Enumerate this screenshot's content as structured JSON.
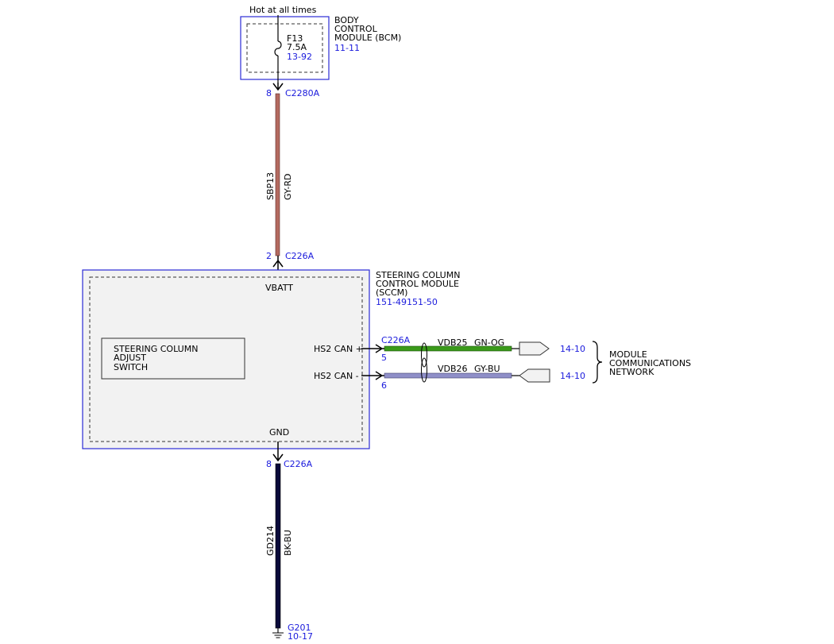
{
  "colors": {
    "module_outline": "#2b2bd6",
    "ref_text": "#1a1adc",
    "module_fill": "#f2f2f2",
    "wire_gy_rd": "#b46a60",
    "wire_gn_og": "#3a9a1a",
    "wire_gy_bu": "#8f8fc8",
    "wire_bk_bu": "#0a0a3a"
  },
  "power": {
    "hot_label": "Hot at all times"
  },
  "bcm": {
    "name_lines": [
      "BODY",
      "CONTROL",
      "MODULE (BCM)"
    ],
    "ref": "11-11",
    "fuse": {
      "id": "F13",
      "rating": "7.5A",
      "ref": "13-92"
    }
  },
  "connectors": {
    "bcm_out": {
      "pin": "8",
      "name": "C2280A"
    },
    "sccm_vbatt": {
      "pin": "2",
      "name": "C226A"
    },
    "sccm_can": {
      "name": "C226A",
      "pin_plus": "5",
      "pin_minus": "6"
    },
    "sccm_gnd": {
      "pin": "8",
      "name": "C226A"
    }
  },
  "wires": {
    "power": {
      "circuit": "SBP13",
      "color": "GY-RD"
    },
    "can_high": {
      "circuit": "VDB25",
      "color": "GN-OG",
      "ref": "14-10"
    },
    "can_low": {
      "circuit": "VDB26",
      "color": "GY-BU",
      "ref": "14-10"
    },
    "ground": {
      "circuit": "GD214",
      "color": "BK-BU"
    }
  },
  "sccm": {
    "name_lines": [
      "STEERING COLUMN",
      "CONTROL MODULE",
      "(SCCM)"
    ],
    "ref": "151-49151-50",
    "vbatt_label": "VBATT",
    "gnd_label": "GND",
    "hs2_plus_label": "HS2 CAN +",
    "hs2_minus_label": "HS2 CAN -",
    "switch_lines": [
      "STEERING COLUMN",
      "ADJUST",
      "SWITCH"
    ]
  },
  "network": {
    "name_lines": [
      "MODULE",
      "COMMUNICATIONS",
      "NETWORK"
    ]
  },
  "ground_point": {
    "name": "G201",
    "ref": "10-17"
  }
}
